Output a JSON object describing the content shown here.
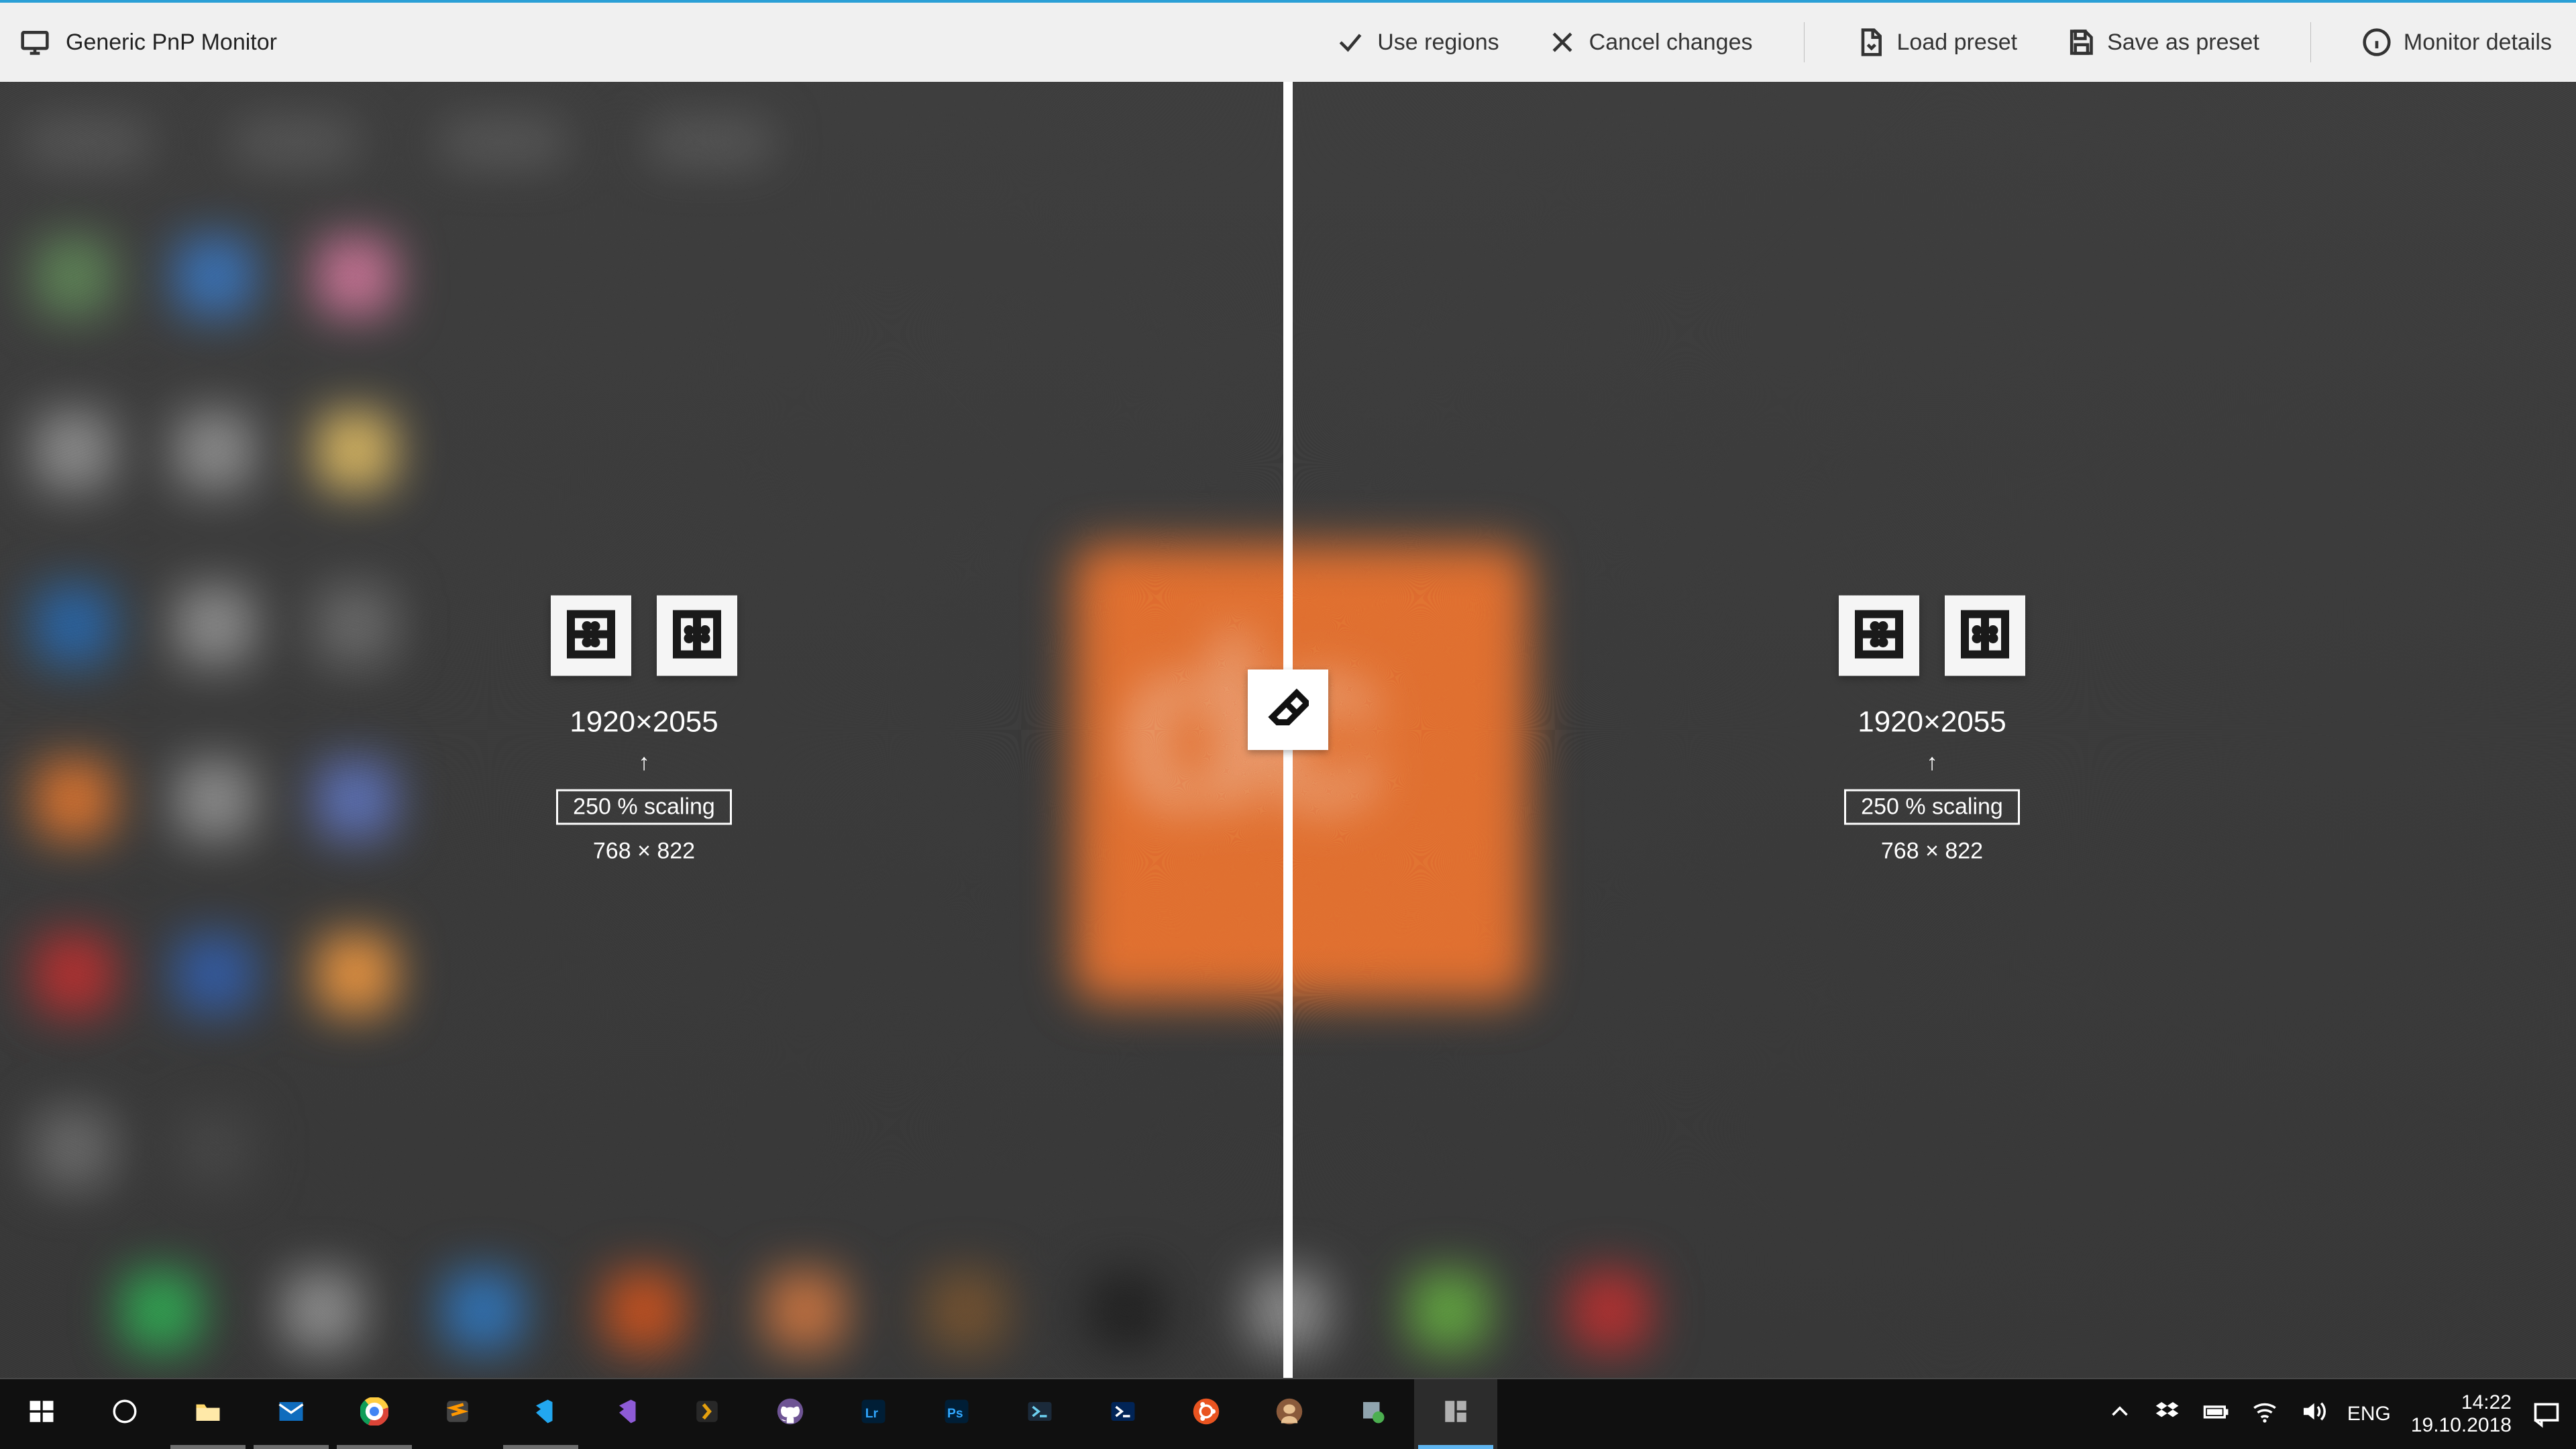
{
  "topbar": {
    "monitor_name": "Generic PnP Monitor",
    "use_regions": "Use regions",
    "cancel_changes": "Cancel changes",
    "load_preset": "Load preset",
    "save_preset": "Save as preset",
    "monitor_details": "Monitor details"
  },
  "regions": {
    "left": {
      "physical": "1920×2055",
      "scaling": "250 % scaling",
      "logical": "768 × 822"
    },
    "right": {
      "physical": "1920×2055",
      "scaling": "250 % scaling",
      "logical": "768 × 822"
    }
  },
  "arrow_glyph": "↑",
  "taskbar": {
    "lang": "ENG",
    "time": "14:22",
    "date": "19.10.2018"
  }
}
